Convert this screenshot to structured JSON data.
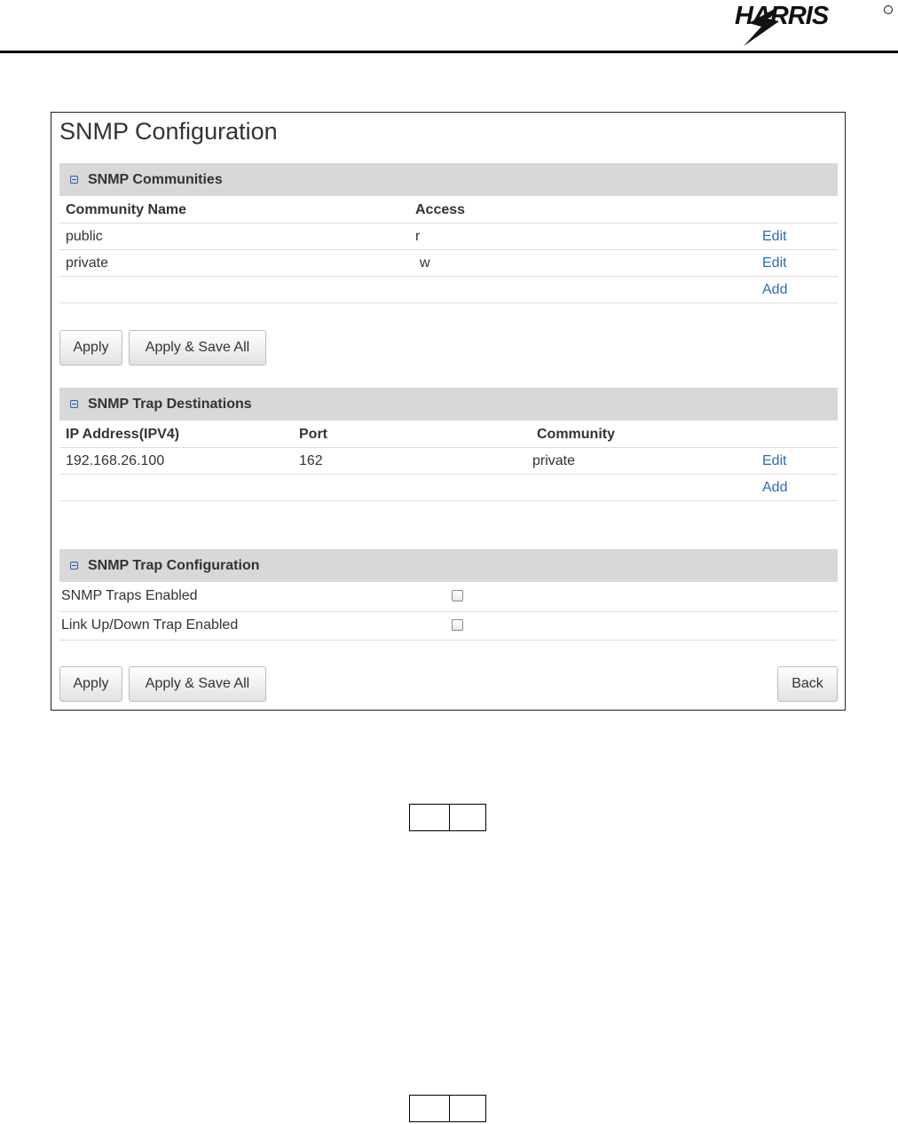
{
  "logo": {
    "text": "HARRIS"
  },
  "snmp": {
    "title": "SNMP Configuration",
    "communities": {
      "section_title": "SNMP Communities",
      "headers": {
        "name": "Community Name",
        "access": "Access"
      },
      "rows": [
        {
          "name": "public",
          "access": "r",
          "action": "Edit"
        },
        {
          "name": "private",
          "access": "w",
          "action": "Edit"
        }
      ],
      "add_label": "Add",
      "apply_label": "Apply",
      "apply_save_label": "Apply & Save All"
    },
    "trap_destinations": {
      "section_title": "SNMP Trap Destinations",
      "headers": {
        "ip": "IP Address(IPV4)",
        "port": "Port",
        "community": "Community"
      },
      "rows": [
        {
          "ip": "192.168.26.100",
          "port": "162",
          "community": "private",
          "action": "Edit"
        }
      ],
      "add_label": "Add"
    },
    "trap_config": {
      "section_title": "SNMP Trap Configuration",
      "settings": [
        {
          "label": "SNMP Traps Enabled",
          "checked": false
        },
        {
          "label": "Link Up/Down Trap Enabled",
          "checked": false
        }
      ],
      "apply_label": "Apply",
      "apply_save_label": "Apply & Save All",
      "back_label": "Back"
    }
  }
}
